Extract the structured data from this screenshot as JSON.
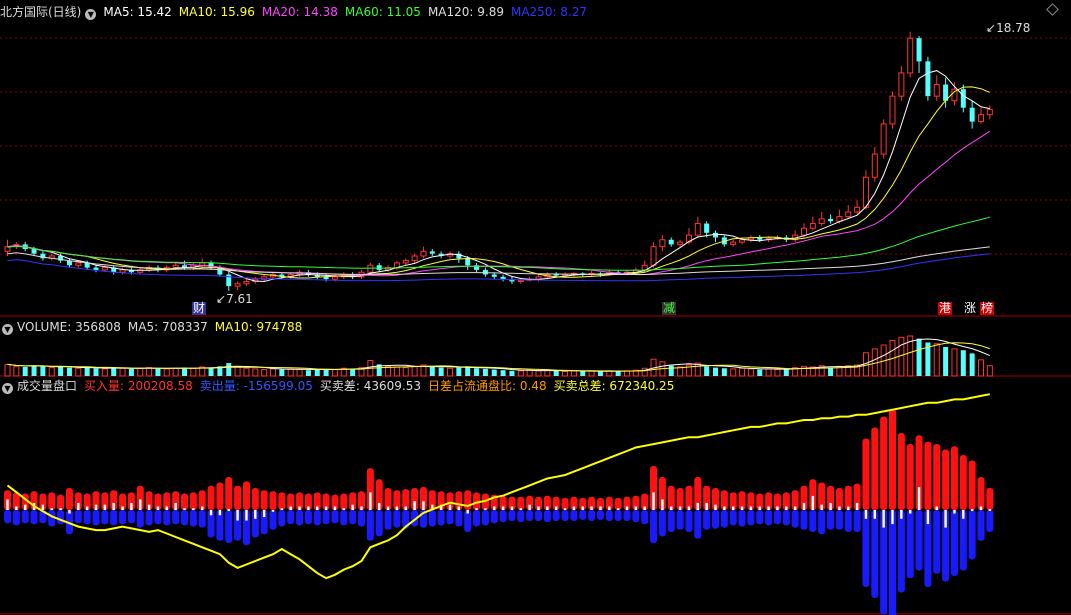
{
  "main": {
    "title": "北方国际(日线)",
    "ma": [
      {
        "label": "MA5: 15.42",
        "color": "#ffffff"
      },
      {
        "label": "MA10: 15.96",
        "color": "#ffff33"
      },
      {
        "label": "MA20: 14.38",
        "color": "#ff44ff"
      },
      {
        "label": "MA60: 11.05",
        "color": "#33ff33"
      },
      {
        "label": "MA120: 9.89",
        "color": "#dddddd"
      },
      {
        "label": "MA250: 8.27",
        "color": "#3333ff"
      }
    ],
    "high_label": "18.78",
    "low_label": "7.61",
    "events": [
      {
        "text": "财",
        "fg": "#ffffff",
        "bg": "#333399"
      },
      {
        "text": "减",
        "fg": "#33ff33",
        "bg": "#333333"
      },
      {
        "text": "港",
        "fg": "#ffffff",
        "bg": "#cc0000"
      },
      {
        "text": "涨",
        "fg": "#ffffff",
        "bg": "#000000"
      },
      {
        "text": "榜",
        "fg": "#ffffff",
        "bg": "#cc0000"
      }
    ]
  },
  "volume_panel": {
    "label": "VOLUME: 356808",
    "ma5": "MA5: 708337",
    "ma10": "MA10: 974788"
  },
  "order_panel": {
    "title": "成交量盘口",
    "buy": "买入量: 200208.58",
    "sell": "卖出量: -156599.05",
    "diff": "买卖差: 43609.53",
    "ratio": "日差占流通盘比: 0.48",
    "total": "买卖总差: 672340.25"
  },
  "colors": {
    "up": "#ff3333",
    "down": "#54ffff",
    "buy_bar": "#ff1111",
    "sell_bar": "#1a1aff",
    "diff_bar": "#ffffff",
    "cum_line": "#ffff00",
    "grid": "#880000",
    "text_red": "#ff3333",
    "text_blue": "#3355ff",
    "text_white": "#dddddd",
    "text_orange": "#ff9900",
    "text_yellow": "#ffff33"
  },
  "candles": [
    [
      9.3,
      9.5,
      9.8,
      9.1
    ],
    [
      9.5,
      9.6,
      9.7,
      9.4
    ],
    [
      9.6,
      9.4,
      9.7,
      9.3
    ],
    [
      9.4,
      9.2,
      9.5,
      9.1
    ],
    [
      9.2,
      9.0,
      9.3,
      8.9
    ],
    [
      9.0,
      9.1,
      9.2,
      8.9
    ],
    [
      9.1,
      8.9,
      9.2,
      8.8
    ],
    [
      8.9,
      8.7,
      9.0,
      8.6
    ],
    [
      8.7,
      8.8,
      8.9,
      8.6
    ],
    [
      8.8,
      8.6,
      8.9,
      8.5
    ],
    [
      8.6,
      8.5,
      8.7,
      8.4
    ],
    [
      8.5,
      8.6,
      8.7,
      8.4
    ],
    [
      8.6,
      8.4,
      8.7,
      8.3
    ],
    [
      8.4,
      8.5,
      8.6,
      8.3
    ],
    [
      8.5,
      8.4,
      8.6,
      8.3
    ],
    [
      8.4,
      8.5,
      8.6,
      8.3
    ],
    [
      8.5,
      8.6,
      8.7,
      8.4
    ],
    [
      8.6,
      8.5,
      8.7,
      8.4
    ],
    [
      8.5,
      8.6,
      8.7,
      8.4
    ],
    [
      8.6,
      8.7,
      8.8,
      8.5
    ],
    [
      8.7,
      8.6,
      8.9,
      8.5
    ],
    [
      8.6,
      8.7,
      8.8,
      8.5
    ],
    [
      8.7,
      8.8,
      9.0,
      8.6
    ],
    [
      8.8,
      8.6,
      8.9,
      8.5
    ],
    [
      8.6,
      8.3,
      8.7,
      8.2
    ],
    [
      8.3,
      7.8,
      8.4,
      7.6
    ],
    [
      7.8,
      7.9,
      8.0,
      7.61
    ],
    [
      7.9,
      8.0,
      8.1,
      7.8
    ],
    [
      8.0,
      8.1,
      8.2,
      7.9
    ],
    [
      8.1,
      8.2,
      8.3,
      8.0
    ],
    [
      8.2,
      8.3,
      8.4,
      8.1
    ],
    [
      8.3,
      8.2,
      8.4,
      8.1
    ],
    [
      8.2,
      8.3,
      8.4,
      8.1
    ],
    [
      8.3,
      8.4,
      8.5,
      8.2
    ],
    [
      8.4,
      8.3,
      8.5,
      8.2
    ],
    [
      8.3,
      8.2,
      8.4,
      8.1
    ],
    [
      8.2,
      8.1,
      8.3,
      8.0
    ],
    [
      8.1,
      8.2,
      8.3,
      8.0
    ],
    [
      8.2,
      8.3,
      8.4,
      8.1
    ],
    [
      8.3,
      8.2,
      8.4,
      8.1
    ],
    [
      8.2,
      8.4,
      8.5,
      8.1
    ],
    [
      8.4,
      8.7,
      8.8,
      8.3
    ],
    [
      8.7,
      8.5,
      8.8,
      8.4
    ],
    [
      8.5,
      8.6,
      8.7,
      8.4
    ],
    [
      8.6,
      8.8,
      8.9,
      8.5
    ],
    [
      8.8,
      8.9,
      9.0,
      8.7
    ],
    [
      8.9,
      9.1,
      9.2,
      8.8
    ],
    [
      9.1,
      9.3,
      9.5,
      9.0
    ],
    [
      9.3,
      9.2,
      9.4,
      9.1
    ],
    [
      9.2,
      9.1,
      9.3,
      9.0
    ],
    [
      9.1,
      9.2,
      9.3,
      9.0
    ],
    [
      9.2,
      9.0,
      9.3,
      8.8
    ],
    [
      9.0,
      8.7,
      9.1,
      8.5
    ],
    [
      8.7,
      8.5,
      8.8,
      8.4
    ],
    [
      8.5,
      8.3,
      8.6,
      8.2
    ],
    [
      8.3,
      8.2,
      8.4,
      8.1
    ],
    [
      8.2,
      8.1,
      8.3,
      8.0
    ],
    [
      8.1,
      8.0,
      8.2,
      7.9
    ],
    [
      8.0,
      8.05,
      8.1,
      7.9
    ],
    [
      8.05,
      8.1,
      8.2,
      8.0
    ],
    [
      8.1,
      8.2,
      8.3,
      8.0
    ],
    [
      8.2,
      8.3,
      8.4,
      8.1
    ],
    [
      8.3,
      8.25,
      8.4,
      8.2
    ],
    [
      8.25,
      8.3,
      8.4,
      8.2
    ],
    [
      8.3,
      8.35,
      8.4,
      8.2
    ],
    [
      8.35,
      8.3,
      8.4,
      8.2
    ],
    [
      8.3,
      8.35,
      8.45,
      8.2
    ],
    [
      8.35,
      8.3,
      8.4,
      8.2
    ],
    [
      8.3,
      8.4,
      8.5,
      8.25
    ],
    [
      8.4,
      8.35,
      8.5,
      8.3
    ],
    [
      8.35,
      8.4,
      8.5,
      8.3
    ],
    [
      8.4,
      8.5,
      8.6,
      8.3
    ],
    [
      8.5,
      8.7,
      8.9,
      8.4
    ],
    [
      8.7,
      9.5,
      9.7,
      8.6
    ],
    [
      9.5,
      9.8,
      10.0,
      9.3
    ],
    [
      9.8,
      9.6,
      9.9,
      9.5
    ],
    [
      9.6,
      9.7,
      9.8,
      9.5
    ],
    [
      9.7,
      10.0,
      10.3,
      9.6
    ],
    [
      10.0,
      10.5,
      10.8,
      9.9
    ],
    [
      10.5,
      10.1,
      10.6,
      9.9
    ],
    [
      10.1,
      9.9,
      10.2,
      9.7
    ],
    [
      9.9,
      9.6,
      10.0,
      9.5
    ],
    [
      9.6,
      9.7,
      9.8,
      9.5
    ],
    [
      9.7,
      9.8,
      9.9,
      9.6
    ],
    [
      9.8,
      9.9,
      10.0,
      9.7
    ],
    [
      9.9,
      9.8,
      10.0,
      9.7
    ],
    [
      9.8,
      9.85,
      9.95,
      9.7
    ],
    [
      9.85,
      9.9,
      10.0,
      9.8
    ],
    [
      9.9,
      9.8,
      10.0,
      9.7
    ],
    [
      9.8,
      10.0,
      10.2,
      9.7
    ],
    [
      10.0,
      10.3,
      10.5,
      9.9
    ],
    [
      10.3,
      10.5,
      10.8,
      10.2
    ],
    [
      10.5,
      10.7,
      11.0,
      10.4
    ],
    [
      10.7,
      10.6,
      10.9,
      10.5
    ],
    [
      10.6,
      10.8,
      11.1,
      10.5
    ],
    [
      10.8,
      11.0,
      11.3,
      10.7
    ],
    [
      11.0,
      11.2,
      11.5,
      10.9
    ],
    [
      11.2,
      12.5,
      12.8,
      11.1
    ],
    [
      12.5,
      13.5,
      13.8,
      12.3
    ],
    [
      13.5,
      14.8,
      15.0,
      13.3
    ],
    [
      14.8,
      16.0,
      16.2,
      14.6
    ],
    [
      16.0,
      17.0,
      17.3,
      15.8
    ],
    [
      17.0,
      18.5,
      18.78,
      16.8
    ],
    [
      18.5,
      17.5,
      18.6,
      17.0
    ],
    [
      17.5,
      16.0,
      17.7,
      15.8
    ],
    [
      16.0,
      16.5,
      16.9,
      15.8
    ],
    [
      16.5,
      15.8,
      16.8,
      15.5
    ],
    [
      15.8,
      16.3,
      16.6,
      15.6
    ],
    [
      16.3,
      15.5,
      16.5,
      15.3
    ],
    [
      15.5,
      14.9,
      15.8,
      14.6
    ],
    [
      14.9,
      15.2,
      15.5,
      14.8
    ],
    [
      15.2,
      15.42,
      15.6,
      15.0
    ]
  ],
  "volumes": [
    0.18,
    0.15,
    0.14,
    0.16,
    0.15,
    0.13,
    0.14,
    0.13,
    0.12,
    0.13,
    0.12,
    0.11,
    0.13,
    0.12,
    0.11,
    0.12,
    0.13,
    0.12,
    0.11,
    0.12,
    0.13,
    0.12,
    0.14,
    0.13,
    0.15,
    0.2,
    0.14,
    0.12,
    0.11,
    0.1,
    0.11,
    0.1,
    0.11,
    0.1,
    0.09,
    0.1,
    0.11,
    0.1,
    0.12,
    0.11,
    0.13,
    0.24,
    0.18,
    0.15,
    0.14,
    0.13,
    0.15,
    0.17,
    0.14,
    0.13,
    0.12,
    0.13,
    0.15,
    0.12,
    0.11,
    0.1,
    0.09,
    0.08,
    0.08,
    0.09,
    0.08,
    0.09,
    0.08,
    0.07,
    0.08,
    0.07,
    0.08,
    0.07,
    0.08,
    0.07,
    0.08,
    0.09,
    0.12,
    0.26,
    0.22,
    0.16,
    0.14,
    0.17,
    0.2,
    0.15,
    0.13,
    0.12,
    0.11,
    0.12,
    0.11,
    0.1,
    0.11,
    0.1,
    0.11,
    0.13,
    0.15,
    0.14,
    0.16,
    0.13,
    0.15,
    0.16,
    0.17,
    0.36,
    0.42,
    0.48,
    0.55,
    0.6,
    0.62,
    0.58,
    0.52,
    0.5,
    0.45,
    0.42,
    0.4,
    0.35,
    0.25,
    0.16
  ],
  "order_bars": [
    [
      0.18,
      0.12
    ],
    [
      0.16,
      0.14
    ],
    [
      0.15,
      0.12
    ],
    [
      0.17,
      0.13
    ],
    [
      0.15,
      0.12
    ],
    [
      0.16,
      0.15
    ],
    [
      0.14,
      0.13
    ],
    [
      0.2,
      0.22
    ],
    [
      0.16,
      0.12
    ],
    [
      0.15,
      0.13
    ],
    [
      0.17,
      0.14
    ],
    [
      0.16,
      0.13
    ],
    [
      0.18,
      0.14
    ],
    [
      0.15,
      0.13
    ],
    [
      0.16,
      0.12
    ],
    [
      0.22,
      0.16
    ],
    [
      0.17,
      0.14
    ],
    [
      0.15,
      0.13
    ],
    [
      0.16,
      0.14
    ],
    [
      0.17,
      0.13
    ],
    [
      0.15,
      0.14
    ],
    [
      0.16,
      0.15
    ],
    [
      0.18,
      0.16
    ],
    [
      0.22,
      0.25
    ],
    [
      0.25,
      0.28
    ],
    [
      0.3,
      0.3
    ],
    [
      0.22,
      0.28
    ],
    [
      0.26,
      0.32
    ],
    [
      0.2,
      0.25
    ],
    [
      0.18,
      0.22
    ],
    [
      0.17,
      0.18
    ],
    [
      0.16,
      0.15
    ],
    [
      0.15,
      0.13
    ],
    [
      0.16,
      0.14
    ],
    [
      0.15,
      0.13
    ],
    [
      0.16,
      0.14
    ],
    [
      0.15,
      0.13
    ],
    [
      0.14,
      0.12
    ],
    [
      0.15,
      0.14
    ],
    [
      0.16,
      0.13
    ],
    [
      0.17,
      0.15
    ],
    [
      0.38,
      0.28
    ],
    [
      0.28,
      0.24
    ],
    [
      0.2,
      0.18
    ],
    [
      0.18,
      0.16
    ],
    [
      0.19,
      0.17
    ],
    [
      0.2,
      0.15
    ],
    [
      0.21,
      0.16
    ],
    [
      0.18,
      0.15
    ],
    [
      0.17,
      0.14
    ],
    [
      0.16,
      0.13
    ],
    [
      0.17,
      0.15
    ],
    [
      0.18,
      0.2
    ],
    [
      0.16,
      0.15
    ],
    [
      0.15,
      0.14
    ],
    [
      0.14,
      0.12
    ],
    [
      0.13,
      0.11
    ],
    [
      0.12,
      0.1
    ],
    [
      0.12,
      0.11
    ],
    [
      0.13,
      0.1
    ],
    [
      0.12,
      0.1
    ],
    [
      0.13,
      0.11
    ],
    [
      0.12,
      0.1
    ],
    [
      0.11,
      0.1
    ],
    [
      0.12,
      0.1
    ],
    [
      0.11,
      0.09
    ],
    [
      0.12,
      0.1
    ],
    [
      0.11,
      0.09
    ],
    [
      0.12,
      0.1
    ],
    [
      0.11,
      0.1
    ],
    [
      0.12,
      0.1
    ],
    [
      0.13,
      0.11
    ],
    [
      0.15,
      0.13
    ],
    [
      0.4,
      0.3
    ],
    [
      0.3,
      0.24
    ],
    [
      0.22,
      0.2
    ],
    [
      0.2,
      0.18
    ],
    [
      0.22,
      0.2
    ],
    [
      0.3,
      0.26
    ],
    [
      0.22,
      0.18
    ],
    [
      0.2,
      0.17
    ],
    [
      0.18,
      0.16
    ],
    [
      0.16,
      0.14
    ],
    [
      0.17,
      0.15
    ],
    [
      0.16,
      0.14
    ],
    [
      0.15,
      0.13
    ],
    [
      0.16,
      0.14
    ],
    [
      0.15,
      0.13
    ],
    [
      0.16,
      0.14
    ],
    [
      0.18,
      0.16
    ],
    [
      0.22,
      0.18
    ],
    [
      0.28,
      0.2
    ],
    [
      0.25,
      0.22
    ],
    [
      0.22,
      0.18
    ],
    [
      0.2,
      0.18
    ],
    [
      0.22,
      0.2
    ],
    [
      0.24,
      0.2
    ],
    [
      0.65,
      0.7
    ],
    [
      0.75,
      0.8
    ],
    [
      0.85,
      0.95
    ],
    [
      0.92,
      1.0
    ],
    [
      0.7,
      0.75
    ],
    [
      0.6,
      0.62
    ],
    [
      0.68,
      0.55
    ],
    [
      0.62,
      0.7
    ],
    [
      0.6,
      0.58
    ],
    [
      0.55,
      0.65
    ],
    [
      0.58,
      0.6
    ],
    [
      0.5,
      0.55
    ],
    [
      0.45,
      0.45
    ],
    [
      0.3,
      0.28
    ],
    [
      0.2,
      0.2
    ]
  ],
  "cum_line": [
    0.62,
    0.58,
    0.54,
    0.5,
    0.47,
    0.44,
    0.42,
    0.4,
    0.38,
    0.37,
    0.36,
    0.36,
    0.37,
    0.38,
    0.37,
    0.36,
    0.35,
    0.36,
    0.34,
    0.32,
    0.3,
    0.28,
    0.26,
    0.24,
    0.22,
    0.17,
    0.14,
    0.16,
    0.18,
    0.2,
    0.22,
    0.25,
    0.22,
    0.19,
    0.15,
    0.11,
    0.08,
    0.1,
    0.13,
    0.15,
    0.18,
    0.26,
    0.28,
    0.3,
    0.33,
    0.38,
    0.42,
    0.46,
    0.48,
    0.5,
    0.52,
    0.51,
    0.5,
    0.52,
    0.53,
    0.55,
    0.56,
    0.58,
    0.6,
    0.62,
    0.64,
    0.66,
    0.67,
    0.68,
    0.7,
    0.72,
    0.74,
    0.76,
    0.78,
    0.8,
    0.82,
    0.84,
    0.85,
    0.86,
    0.87,
    0.88,
    0.89,
    0.9,
    0.9,
    0.91,
    0.92,
    0.93,
    0.94,
    0.95,
    0.96,
    0.96,
    0.97,
    0.98,
    0.98,
    0.99,
    1.0,
    1.0,
    1.01,
    1.01,
    1.02,
    1.02,
    1.03,
    1.03,
    1.04,
    1.05,
    1.06,
    1.07,
    1.08,
    1.09,
    1.1,
    1.1,
    1.11,
    1.12,
    1.12,
    1.13,
    1.14,
    1.15
  ]
}
